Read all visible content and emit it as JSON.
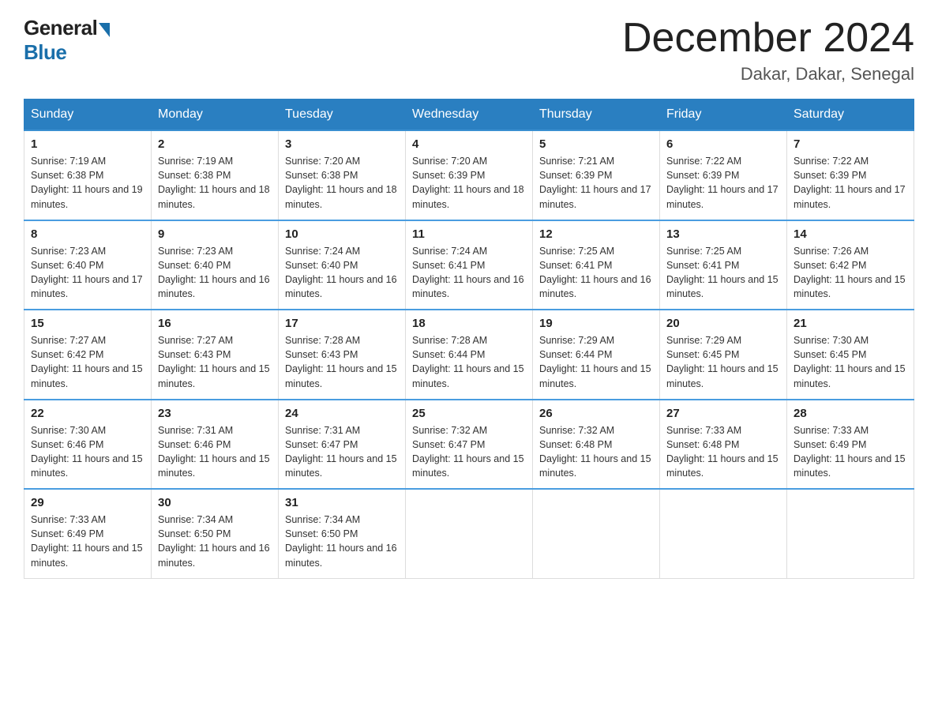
{
  "header": {
    "logo_general": "General",
    "logo_blue": "Blue",
    "month_title": "December 2024",
    "location": "Dakar, Dakar, Senegal"
  },
  "days_of_week": [
    "Sunday",
    "Monday",
    "Tuesday",
    "Wednesday",
    "Thursday",
    "Friday",
    "Saturday"
  ],
  "weeks": [
    [
      {
        "day": "1",
        "sunrise": "7:19 AM",
        "sunset": "6:38 PM",
        "daylight": "11 hours and 19 minutes."
      },
      {
        "day": "2",
        "sunrise": "7:19 AM",
        "sunset": "6:38 PM",
        "daylight": "11 hours and 18 minutes."
      },
      {
        "day": "3",
        "sunrise": "7:20 AM",
        "sunset": "6:38 PM",
        "daylight": "11 hours and 18 minutes."
      },
      {
        "day": "4",
        "sunrise": "7:20 AM",
        "sunset": "6:39 PM",
        "daylight": "11 hours and 18 minutes."
      },
      {
        "day": "5",
        "sunrise": "7:21 AM",
        "sunset": "6:39 PM",
        "daylight": "11 hours and 17 minutes."
      },
      {
        "day": "6",
        "sunrise": "7:22 AM",
        "sunset": "6:39 PM",
        "daylight": "11 hours and 17 minutes."
      },
      {
        "day": "7",
        "sunrise": "7:22 AM",
        "sunset": "6:39 PM",
        "daylight": "11 hours and 17 minutes."
      }
    ],
    [
      {
        "day": "8",
        "sunrise": "7:23 AM",
        "sunset": "6:40 PM",
        "daylight": "11 hours and 17 minutes."
      },
      {
        "day": "9",
        "sunrise": "7:23 AM",
        "sunset": "6:40 PM",
        "daylight": "11 hours and 16 minutes."
      },
      {
        "day": "10",
        "sunrise": "7:24 AM",
        "sunset": "6:40 PM",
        "daylight": "11 hours and 16 minutes."
      },
      {
        "day": "11",
        "sunrise": "7:24 AM",
        "sunset": "6:41 PM",
        "daylight": "11 hours and 16 minutes."
      },
      {
        "day": "12",
        "sunrise": "7:25 AM",
        "sunset": "6:41 PM",
        "daylight": "11 hours and 16 minutes."
      },
      {
        "day": "13",
        "sunrise": "7:25 AM",
        "sunset": "6:41 PM",
        "daylight": "11 hours and 15 minutes."
      },
      {
        "day": "14",
        "sunrise": "7:26 AM",
        "sunset": "6:42 PM",
        "daylight": "11 hours and 15 minutes."
      }
    ],
    [
      {
        "day": "15",
        "sunrise": "7:27 AM",
        "sunset": "6:42 PM",
        "daylight": "11 hours and 15 minutes."
      },
      {
        "day": "16",
        "sunrise": "7:27 AM",
        "sunset": "6:43 PM",
        "daylight": "11 hours and 15 minutes."
      },
      {
        "day": "17",
        "sunrise": "7:28 AM",
        "sunset": "6:43 PM",
        "daylight": "11 hours and 15 minutes."
      },
      {
        "day": "18",
        "sunrise": "7:28 AM",
        "sunset": "6:44 PM",
        "daylight": "11 hours and 15 minutes."
      },
      {
        "day": "19",
        "sunrise": "7:29 AM",
        "sunset": "6:44 PM",
        "daylight": "11 hours and 15 minutes."
      },
      {
        "day": "20",
        "sunrise": "7:29 AM",
        "sunset": "6:45 PM",
        "daylight": "11 hours and 15 minutes."
      },
      {
        "day": "21",
        "sunrise": "7:30 AM",
        "sunset": "6:45 PM",
        "daylight": "11 hours and 15 minutes."
      }
    ],
    [
      {
        "day": "22",
        "sunrise": "7:30 AM",
        "sunset": "6:46 PM",
        "daylight": "11 hours and 15 minutes."
      },
      {
        "day": "23",
        "sunrise": "7:31 AM",
        "sunset": "6:46 PM",
        "daylight": "11 hours and 15 minutes."
      },
      {
        "day": "24",
        "sunrise": "7:31 AM",
        "sunset": "6:47 PM",
        "daylight": "11 hours and 15 minutes."
      },
      {
        "day": "25",
        "sunrise": "7:32 AM",
        "sunset": "6:47 PM",
        "daylight": "11 hours and 15 minutes."
      },
      {
        "day": "26",
        "sunrise": "7:32 AM",
        "sunset": "6:48 PM",
        "daylight": "11 hours and 15 minutes."
      },
      {
        "day": "27",
        "sunrise": "7:33 AM",
        "sunset": "6:48 PM",
        "daylight": "11 hours and 15 minutes."
      },
      {
        "day": "28",
        "sunrise": "7:33 AM",
        "sunset": "6:49 PM",
        "daylight": "11 hours and 15 minutes."
      }
    ],
    [
      {
        "day": "29",
        "sunrise": "7:33 AM",
        "sunset": "6:49 PM",
        "daylight": "11 hours and 15 minutes."
      },
      {
        "day": "30",
        "sunrise": "7:34 AM",
        "sunset": "6:50 PM",
        "daylight": "11 hours and 16 minutes."
      },
      {
        "day": "31",
        "sunrise": "7:34 AM",
        "sunset": "6:50 PM",
        "daylight": "11 hours and 16 minutes."
      },
      null,
      null,
      null,
      null
    ]
  ],
  "labels": {
    "sunrise_prefix": "Sunrise: ",
    "sunset_prefix": "Sunset: ",
    "daylight_prefix": "Daylight: "
  }
}
